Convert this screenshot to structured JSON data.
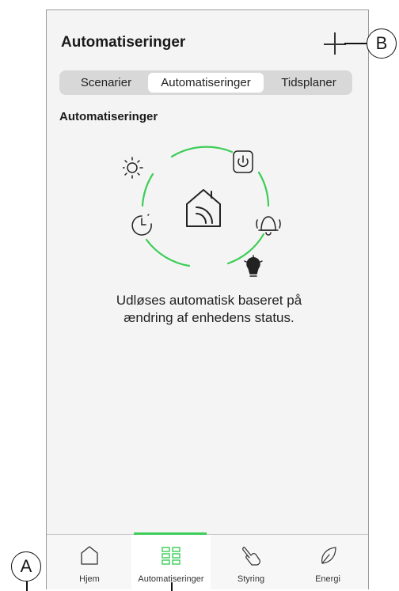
{
  "header": {
    "title": "Automatiseringer"
  },
  "segments": [
    {
      "label": "Scenarier",
      "selected": false
    },
    {
      "label": "Automatiseringer",
      "selected": true
    },
    {
      "label": "Tidsplaner",
      "selected": false
    }
  ],
  "section": {
    "title": "Automatiseringer"
  },
  "illustration": {
    "icons": [
      "sun-icon",
      "power-icon",
      "smart-home-icon",
      "clock-icon",
      "alarm-bell-icon",
      "light-bulb-icon"
    ],
    "accent_color": "#3dcd58"
  },
  "description": {
    "line1": "Udløses automatisk baseret på",
    "line2": "ændring af enhedens status."
  },
  "tabbar": {
    "items": [
      {
        "label": "Hjem",
        "icon": "home-icon",
        "active": false
      },
      {
        "label": "Automatiseringer",
        "icon": "grid-icon",
        "active": true
      },
      {
        "label": "Styring",
        "icon": "hand-pointer-icon",
        "active": false
      },
      {
        "label": "Energi",
        "icon": "leaf-icon",
        "active": false
      }
    ]
  },
  "callouts": {
    "a": "A",
    "b": "B"
  }
}
